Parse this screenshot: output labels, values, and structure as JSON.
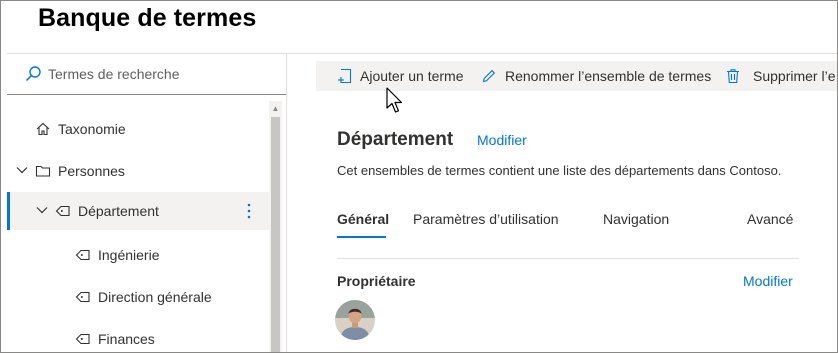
{
  "page": {
    "title": "Banque de termes"
  },
  "search": {
    "placeholder": "Termes de recherche"
  },
  "tree": [
    {
      "label": "Taxonomie",
      "icon": "home-icon"
    },
    {
      "label": "Personnes",
      "icon": "folder-icon",
      "expanded": true
    },
    {
      "label": "Département",
      "icon": "tag-icon",
      "expanded": true,
      "selected": true
    },
    {
      "label": "Ingénierie",
      "icon": "tag-icon"
    },
    {
      "label": "Direction générale",
      "icon": "tag-icon"
    },
    {
      "label": "Finances",
      "icon": "tag-icon"
    }
  ],
  "toolbar": {
    "add_term": "Ajouter un terme",
    "rename_set": "Renommer l’ensemble de termes",
    "delete_set": "Supprimer l’e"
  },
  "detail": {
    "title": "Département",
    "edit_link": "Modifier",
    "description": "Cet ensembles de termes contient une liste des départements dans Contoso.",
    "tabs": [
      {
        "label": "Général",
        "active": true
      },
      {
        "label": "Paramètres d’utilisation"
      },
      {
        "label": "Navigation"
      },
      {
        "label": "Avancé"
      }
    ],
    "owner_label": "Propriétaire",
    "owner_edit_link": "Modifier"
  },
  "colors": {
    "accent": "#0078d4",
    "selected_bg": "#f3f2f1",
    "text": "#323130"
  }
}
